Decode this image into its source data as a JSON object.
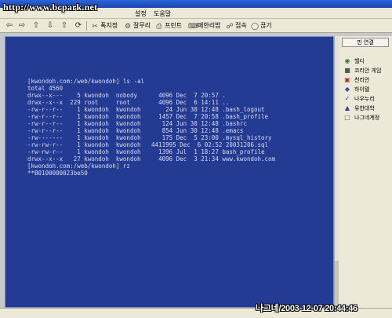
{
  "watermark": "http://www.bcpark.net",
  "menubar": {
    "items": [
      "설정",
      "도움말"
    ]
  },
  "toolbar": {
    "nav_icons": [
      "back-arrow-icon",
      "forward-arrow-icon",
      "up-arrow-icon",
      "download-icon",
      "upload-icon",
      "refresh-icon"
    ],
    "buttons": [
      {
        "label": "폭지정",
        "icon": "scissors-icon"
      },
      {
        "label": "잘무리",
        "icon": "tools-icon"
      },
      {
        "label": "프린트",
        "icon": "printer-icon"
      },
      {
        "label": "매한리밥",
        "icon": "keyboard-icon"
      },
      {
        "label": "접속",
        "icon": "connect-icon"
      },
      {
        "label": "끊기",
        "icon": "disconnect-icon"
      }
    ]
  },
  "terminal": {
    "background": "#233b93",
    "lines": [
      "[kwondoh.com:/web/kwondoh] ls -al",
      "total 4560",
      "drwx--x---    5 kwondoh  nobody      4096 Dec  7 20:57 .",
      "drwx--x--x  229 root     root        4096 Dec  6 14:11 ..",
      "-rw-r--r--    1 kwondoh  kwondoh       24 Jun 30 12:48 .bash_logout",
      "-rw-r--r--    1 kwondoh  kwondoh     1457 Dec  7 20:58 .bash_profile",
      "-rw-r--r--    1 kwondoh  kwondoh      124 Jun 30 12:48 .bashrc",
      "-rw-r--r--    1 kwondoh  kwondoh      854 Jun 30 12:48 .emacs",
      "-rw-------    1 kwondoh  kwondoh      175 Dec  5 23:00 .mysql_history",
      "-rw-rw-r--    1 kwondoh  kwondoh   4411995 Dec  6 02:52 20031206.sql",
      "-rw-rw-r--    1 kwondoh  kwondoh     1396 Jul  1 18:27 bash_profile",
      "drwx--x--x   27 kwondoh  kwondoh     4096 Dec  3 21:34 www.kwondoh.com",
      "[kwondoh.com:/web/kwondoh] rz",
      "**B0100000023be50"
    ]
  },
  "sidebar": {
    "connect_label": "핀 연결",
    "items": [
      {
        "label": "헬디",
        "icon": "shield-icon"
      },
      {
        "label": "코리안 게임",
        "icon": "game-icon"
      },
      {
        "label": "천리안",
        "icon": "chollian-icon"
      },
      {
        "label": "하이텔",
        "icon": "hitel-icon"
      },
      {
        "label": "나우누리",
        "icon": "nownuri-icon"
      },
      {
        "label": "유한대학",
        "icon": "university-icon"
      },
      {
        "label": "나그네계정",
        "icon": "guest-icon"
      }
    ]
  },
  "stamp": "나그네/2003-12-07 20:44:46"
}
